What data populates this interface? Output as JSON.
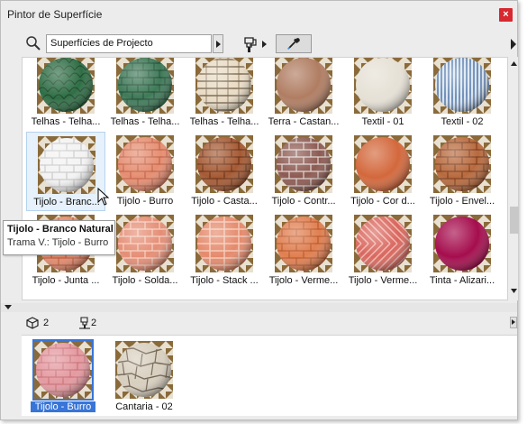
{
  "window": {
    "title": "Pintor de Superfície",
    "close_label": "×"
  },
  "toolbar": {
    "filter_value": "Superfícies de Projecto"
  },
  "grid": {
    "items": [
      {
        "label": "Telhas - Telha...",
        "pattern": "scales",
        "base": "#2f6e45",
        "line": "#1f4a2e"
      },
      {
        "label": "Telhas - Telha...",
        "pattern": "shingles",
        "base": "#3f7a58",
        "line": "#24503a"
      },
      {
        "label": "Telhas - Telha...",
        "pattern": "rings",
        "base": "#e9dcc6",
        "line": "#7c6a52"
      },
      {
        "label": "Terra - Castan...",
        "pattern": "plain",
        "base": "#b07d62",
        "line": "#8c5e45"
      },
      {
        "label": "Textil - 01",
        "pattern": "plain",
        "base": "#e6e1d6",
        "line": "#c8c0b0"
      },
      {
        "label": "Textil - 02",
        "pattern": "stripes",
        "base": "#dbe6f2",
        "line": "#6f8fb8"
      },
      {
        "label": "Tijolo - Branc...",
        "pattern": "brick",
        "base": "#f3f3f3",
        "line": "#c9c9c9",
        "selected": true
      },
      {
        "label": "Tijolo - Burro",
        "pattern": "brick",
        "base": "#e58e72",
        "line": "#c4654a"
      },
      {
        "label": "Tijolo - Casta...",
        "pattern": "brick",
        "base": "#a55a34",
        "line": "#6e3418"
      },
      {
        "label": "Tijolo - Contr...",
        "pattern": "brick",
        "base": "#8c5a52",
        "line": "#e0d4cf"
      },
      {
        "label": "Tijolo - Cor d...",
        "pattern": "plain",
        "base": "#d3683c",
        "line": "#a84822"
      },
      {
        "label": "Tijolo - Envel...",
        "pattern": "brick",
        "base": "#b86a3e",
        "line": "#7e4020"
      },
      {
        "label": "Tijolo - Junta ...",
        "pattern": "brick",
        "base": "#e48a6c",
        "line": "#b95a3e"
      },
      {
        "label": "Tijolo - Solda...",
        "pattern": "brick",
        "base": "#e58e76",
        "line": "#f6d0c0"
      },
      {
        "label": "Tijolo - Stack ...",
        "pattern": "grid",
        "base": "#e58a6c",
        "line": "#f4c8b6"
      },
      {
        "label": "Tijolo - Verme...",
        "pattern": "brick",
        "base": "#e07f50",
        "line": "#b85a30"
      },
      {
        "label": "Tijolo - Verme...",
        "pattern": "herringbone",
        "base": "#d9675e",
        "line": "#f0b8b0"
      },
      {
        "label": "Tinta - Alizari...",
        "pattern": "plain",
        "base": "#a50d4d",
        "line": "#6e0630"
      }
    ]
  },
  "tooltip": {
    "title": "Tijolo - Branco Natural",
    "subtitle": "Trama V.: Tijolo - Burro"
  },
  "info": {
    "objects_count": "2",
    "paint_count": "2"
  },
  "bottom": {
    "items": [
      {
        "label": "Tijolo - Burro",
        "pattern": "brick",
        "base": "#e49aa0",
        "line": "#c9747c",
        "selected": true
      },
      {
        "label": "Cantaria - 02",
        "pattern": "stone",
        "base": "#d8cfbf",
        "line": "#6f6250"
      }
    ]
  },
  "icons": {
    "search": "search-icon",
    "brush": "paint-brush-icon",
    "picker": "eyedropper-icon",
    "cube": "cube-icon",
    "close": "close-icon"
  }
}
